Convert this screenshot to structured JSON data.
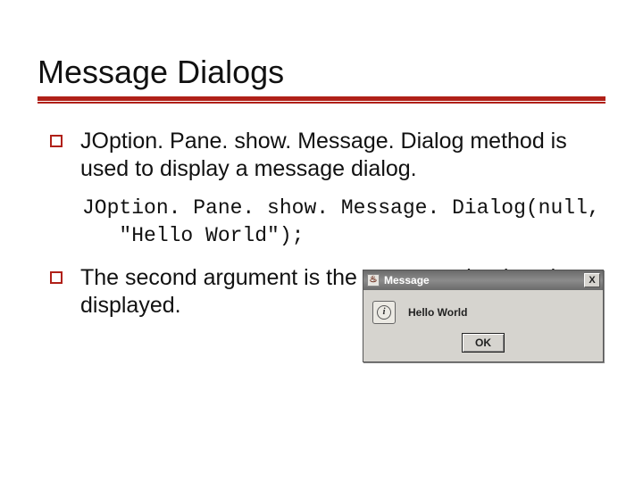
{
  "slide": {
    "title": "Message Dialogs",
    "bullets": [
      "JOption. Pane. show. Message. Dialog method is used to display a message dialog.",
      "The second argument is the message that is to be  displayed."
    ],
    "code": "JOption. Pane. show. Message. Dialog(null,\n   \"Hello World\");"
  },
  "dialog": {
    "title": "Message",
    "java_glyph": "♨",
    "close_glyph": "X",
    "info_glyph": "i",
    "message": "Hello World",
    "ok_label": "OK"
  }
}
